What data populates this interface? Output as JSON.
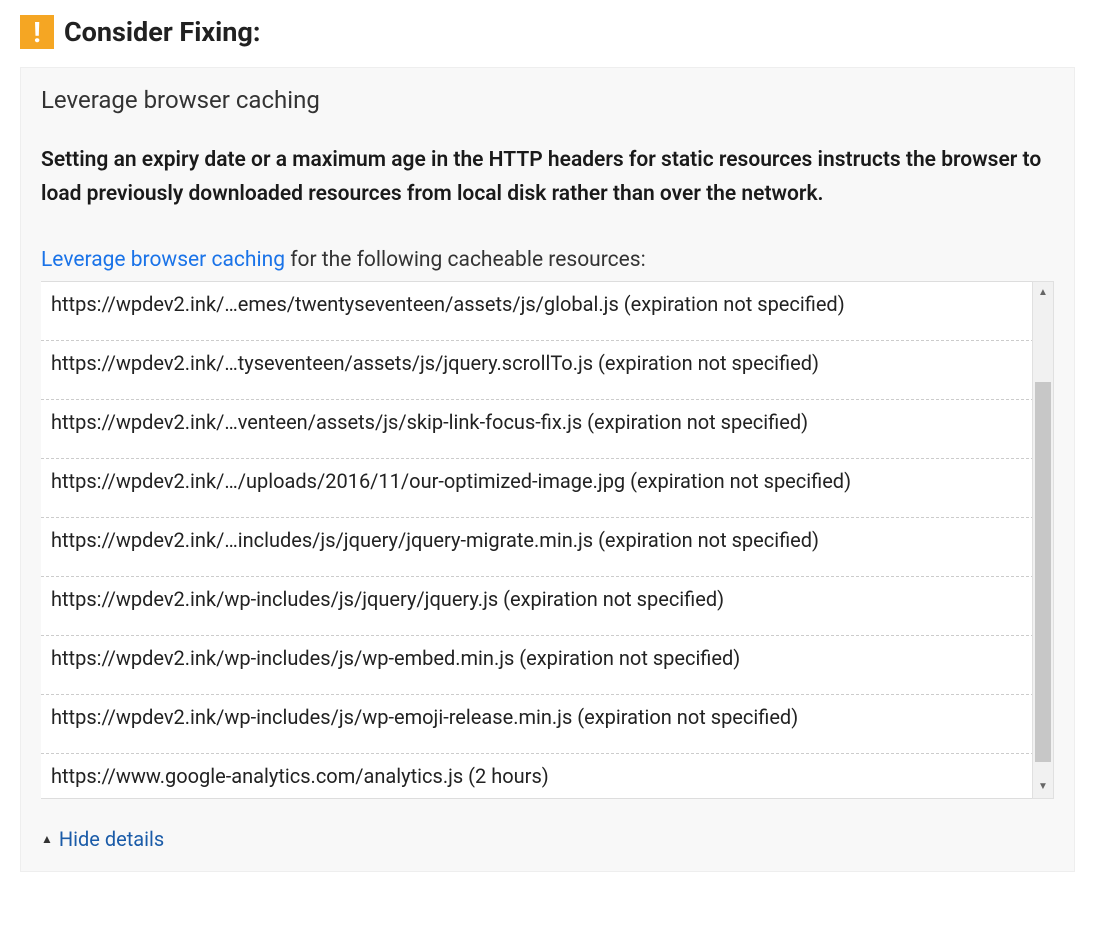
{
  "header": {
    "title": "Consider Fixing:"
  },
  "panel": {
    "subtitle": "Leverage browser caching",
    "description": "Setting an expiry date or a maximum age in the HTTP headers for static resources instructs the browser to load previously downloaded resources from local disk rather than over the network.",
    "instruction_link": "Leverage browser caching",
    "instruction_rest": " for the following cacheable resources:",
    "resources": [
      "https://wpdev2.ink/…emes/twentyseventeen/assets/js/global.js (expiration not specified)",
      "https://wpdev2.ink/…tyseventeen/assets/js/jquery.scrollTo.js (expiration not specified)",
      "https://wpdev2.ink/…venteen/assets/js/skip-link-focus-fix.js (expiration not specified)",
      "https://wpdev2.ink/…/uploads/2016/11/our-optimized-image.jpg (expiration not specified)",
      "https://wpdev2.ink/…includes/js/jquery/jquery-migrate.min.js (expiration not specified)",
      "https://wpdev2.ink/wp-includes/js/jquery/jquery.js (expiration not specified)",
      "https://wpdev2.ink/wp-includes/js/wp-embed.min.js (expiration not specified)",
      "https://wpdev2.ink/wp-includes/js/wp-emoji-release.min.js (expiration not specified)",
      "https://www.google-analytics.com/analytics.js (2 hours)"
    ],
    "hide_details": "Hide details"
  }
}
